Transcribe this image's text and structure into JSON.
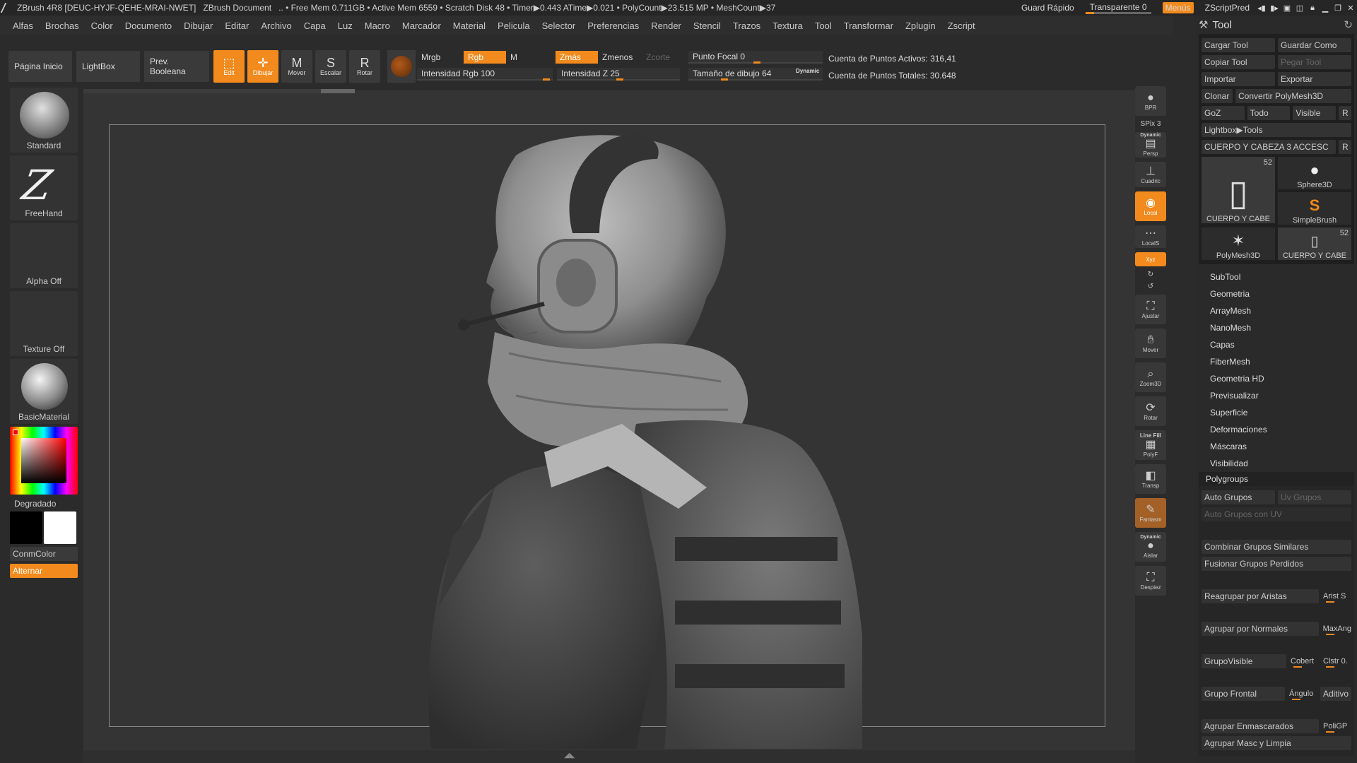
{
  "titlebar": {
    "app": "ZBrush 4R8 [DEUC-HYJF-QEHE-MRAI-NWET]",
    "doc": "ZBrush Document",
    "stats": ".. • Free Mem 0.711GB • Active Mem 6559 • Scratch Disk 48 • Timer▶0.443 ATime▶0.021 • PolyCount▶23.515 MP • MeshCount▶37",
    "quicksave": "Guard Rápido",
    "transparent": "Transparente 0",
    "menus": "Menús",
    "script": "ZScriptPred"
  },
  "menubar": [
    "Alfas",
    "Brochas",
    "Color",
    "Documento",
    "Dibujar",
    "Editar",
    "Archivo",
    "Capa",
    "Luz",
    "Macro",
    "Marcador",
    "Material",
    "Pelicula",
    "Selector",
    "Preferencias",
    "Render",
    "Stencil",
    "Trazos",
    "Textura",
    "Tool",
    "Transformar",
    "Zplugin",
    "Zscript"
  ],
  "toolbar": {
    "home": "Página Inicio",
    "lightbox": "LightBox",
    "boolean": "Prev. Booleana",
    "edit": "Edit",
    "draw": "Dibujar",
    "move": "Mover",
    "scale": "Escalar",
    "rotate": "Rotar"
  },
  "params": {
    "mrgb": "Mrgb",
    "rgb": "Rgb",
    "m": "M",
    "zadd": "Zmás",
    "zsub": "Zmenos",
    "zcut": "Zcorte",
    "rgb_intensity": "Intensidad Rgb 100",
    "z_intensity": "Intensidad Z 25",
    "focal": "Punto Focal 0",
    "draw_size": "Tamaño de dibujo 64",
    "dynamic": "Dynamic",
    "active_points": "Cuenta de Puntos Activos: 316,41",
    "total_points": "Cuenta de Puntos Totales: 30.648"
  },
  "left": {
    "brush": "Standard",
    "stroke": "FreeHand",
    "alpha": "Alpha Off",
    "texture": "Texture Off",
    "material": "BasicMaterial",
    "gradient": "Degradado",
    "conmcolor": "ConmColor",
    "alternate": "Alternar"
  },
  "shelf": {
    "bpr": "BPR",
    "spix": "SPix 3",
    "dynamic": "Dynamic",
    "persp": "Persp",
    "floor": "Cuadric",
    "local": "Local",
    "locals": "LocalS",
    "xyz": "Xyz",
    "frame": "Ajustar",
    "move": "Mover",
    "zoom": "Zoom3D",
    "rotate": "Rotar",
    "linefill": "Line Fill",
    "polyf": "PolyF",
    "transp": "Transp",
    "ghost": "Fantasm",
    "solo": "Aislar",
    "xpose": "Despiez"
  },
  "tool": {
    "title": "Tool",
    "load": "Cargar Tool",
    "saveas": "Guardar Como",
    "copy": "Copiar Tool",
    "paste": "Pegar Tool",
    "import": "Importar",
    "export": "Exportar",
    "clone": "Clonar",
    "polymesh": "Convertir PolyMesh3D",
    "goz": "GoZ",
    "all": "Todo",
    "visible": "Visible",
    "r": "R",
    "lightbox": "Lightbox▶Tools",
    "current": "CUERPO Y CABEZA 3 ACCESC",
    "thumbs": [
      {
        "label": "CUERPO Y CABE",
        "count": "52"
      },
      {
        "label": "Sphere3D",
        "count": ""
      },
      {
        "label": "SimpleBrush",
        "count": ""
      },
      {
        "label": "PolyMesh3D",
        "count": ""
      },
      {
        "label": "CUERPO Y CABE",
        "count": "52"
      }
    ],
    "menu": [
      "SubTool",
      "Geometria",
      "ArrayMesh",
      "NanoMesh",
      "Capas",
      "FiberMesh",
      "Geometria HD",
      "Previsualizar",
      "Superficie",
      "Deformaciones",
      "Máscaras",
      "Visibilidad"
    ],
    "polygroups": "Polygroups",
    "auto": "Auto Grupos",
    "uv": "Uv Grupos",
    "autouv": "Auto Grupos con UV",
    "merge_similar": "Combinar Grupos Similares",
    "merge_stray": "Fusionar Grupos Perdidos",
    "regroup_edges": "Reagrupar por Aristas",
    "edge_s": "Arist S",
    "group_normals": "Agrupar por Normales",
    "maxang": "MaxAng",
    "group_visible": "GrupoVisible",
    "coverage": "Cobert",
    "clstr": "Clstr 0.",
    "group_front": "Grupo Frontal",
    "angle": "Ángulo",
    "additive": "Aditivo",
    "group_masked": "Agrupar Enmascarados",
    "polygp": "PoliGP",
    "group_mask_clear": "Agrupar Masc y Limpia"
  }
}
